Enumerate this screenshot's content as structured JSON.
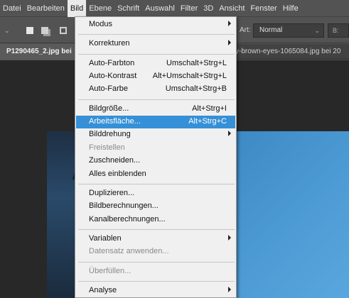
{
  "menubar": {
    "items": [
      "Datei",
      "Bearbeiten",
      "Bild",
      "Ebene",
      "Schrift",
      "Auswahl",
      "Filter",
      "3D",
      "Ansicht",
      "Fenster",
      "Hilfe"
    ],
    "active": "Bild"
  },
  "options_bar": {
    "art_label": "Art:",
    "art_value": "Normal",
    "extra_label": "B:"
  },
  "tabs": [
    {
      "label": "P1290465_2.jpg bei"
    },
    {
      "label": "y-brown-eyes-1065084.jpg bei 20"
    }
  ],
  "menu": {
    "items": [
      {
        "label": "Modus",
        "shortcut": "",
        "submenu": true,
        "disabled": false,
        "highlighted": false
      },
      {
        "sep": true
      },
      {
        "label": "Korrekturen",
        "shortcut": "",
        "submenu": true,
        "disabled": false,
        "highlighted": false
      },
      {
        "sep": true
      },
      {
        "label": "Auto-Farbton",
        "shortcut": "Umschalt+Strg+L",
        "submenu": false,
        "disabled": false,
        "highlighted": false
      },
      {
        "label": "Auto-Kontrast",
        "shortcut": "Alt+Umschalt+Strg+L",
        "submenu": false,
        "disabled": false,
        "highlighted": false
      },
      {
        "label": "Auto-Farbe",
        "shortcut": "Umschalt+Strg+B",
        "submenu": false,
        "disabled": false,
        "highlighted": false
      },
      {
        "sep": true
      },
      {
        "label": "Bildgröße...",
        "shortcut": "Alt+Strg+I",
        "submenu": false,
        "disabled": false,
        "highlighted": false
      },
      {
        "label": "Arbeitsfläche...",
        "shortcut": "Alt+Strg+C",
        "submenu": false,
        "disabled": false,
        "highlighted": true
      },
      {
        "label": "Bilddrehung",
        "shortcut": "",
        "submenu": true,
        "disabled": false,
        "highlighted": false
      },
      {
        "label": "Freistellen",
        "shortcut": "",
        "submenu": false,
        "disabled": true,
        "highlighted": false
      },
      {
        "label": "Zuschneiden...",
        "shortcut": "",
        "submenu": false,
        "disabled": false,
        "highlighted": false
      },
      {
        "label": "Alles einblenden",
        "shortcut": "",
        "submenu": false,
        "disabled": false,
        "highlighted": false
      },
      {
        "sep": true
      },
      {
        "label": "Duplizieren...",
        "shortcut": "",
        "submenu": false,
        "disabled": false,
        "highlighted": false
      },
      {
        "label": "Bildberechnungen...",
        "shortcut": "",
        "submenu": false,
        "disabled": false,
        "highlighted": false
      },
      {
        "label": "Kanalberechnungen...",
        "shortcut": "",
        "submenu": false,
        "disabled": false,
        "highlighted": false
      },
      {
        "sep": true
      },
      {
        "label": "Variablen",
        "shortcut": "",
        "submenu": true,
        "disabled": false,
        "highlighted": false
      },
      {
        "label": "Datensatz anwenden...",
        "shortcut": "",
        "submenu": false,
        "disabled": true,
        "highlighted": false
      },
      {
        "sep": true
      },
      {
        "label": "Überfüllen...",
        "shortcut": "",
        "submenu": false,
        "disabled": true,
        "highlighted": false
      },
      {
        "sep": true
      },
      {
        "label": "Analyse",
        "shortcut": "",
        "submenu": true,
        "disabled": false,
        "highlighted": false
      }
    ]
  },
  "colors": {
    "highlight": "#3690d7",
    "menu_bg": "#f0f0f0",
    "chrome_bg": "#535353"
  }
}
